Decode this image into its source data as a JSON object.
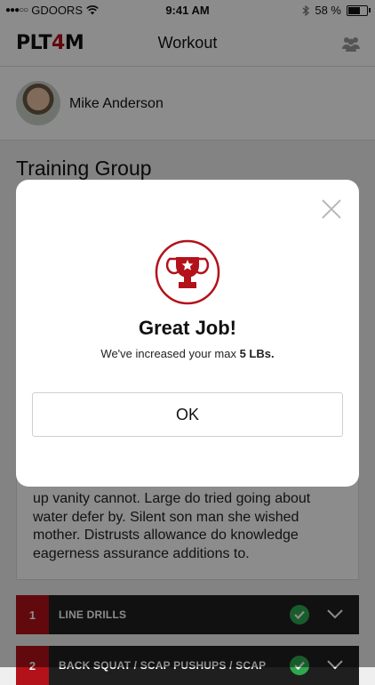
{
  "status_bar": {
    "carrier": "GDOORS",
    "time": "9:41 AM",
    "battery_percent": "58 %",
    "battery_level": 0.58,
    "icons": [
      "signal-dots-icon",
      "wifi-icon",
      "bluetooth-icon",
      "battery-icon"
    ]
  },
  "nav": {
    "logo_prefix": "PLT",
    "logo_accent": "4",
    "logo_suffix": "M",
    "title": "Workout",
    "right_icon": "group-icon"
  },
  "profile": {
    "name": "Mike Anderson"
  },
  "section": {
    "title": "Training Group"
  },
  "description": {
    "text": "up vanity cannot. Large do tried going about water defer by. Silent son man she wished mother. Distrusts allowance do knowledge eagerness assurance additions to."
  },
  "workouts": [
    {
      "number": "1",
      "label": "LINE DRILLS",
      "completed": true
    },
    {
      "number": "2",
      "label": "BACK SQUAT / SCAP PUSHUPS / SCAP",
      "completed": true
    }
  ],
  "modal": {
    "title": "Great Job!",
    "message_prefix": "We've increased your max ",
    "message_value": "5 LBs.",
    "ok_label": "OK",
    "icon": "trophy-icon"
  },
  "colors": {
    "accent": "#b3121a",
    "success": "#2fa84f",
    "row_background": "#1f1f1f"
  }
}
